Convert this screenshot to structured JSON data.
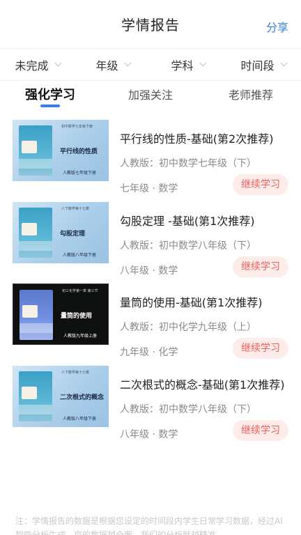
{
  "header": {
    "title": "学情报告",
    "share_label": "分享"
  },
  "filters": [
    "未完成",
    "年级",
    "学科",
    "时间段"
  ],
  "tabs": [
    {
      "label": "强化学习",
      "active": true
    },
    {
      "label": "加强关注",
      "active": false
    },
    {
      "label": "老师推荐",
      "active": false
    }
  ],
  "items": [
    {
      "title": "平行线的性质-基础(第2次推荐)",
      "edition": "人教版：初中数学七年级（下）",
      "meta": "七年级 · 数学",
      "action": "继续学习",
      "cover": {
        "subject": "数学",
        "topic": "平行线的性质",
        "headline": "初中数学七年级下册",
        "publisher": "人教版七年级下册"
      }
    },
    {
      "title": "勾股定理 -基础(第1次推荐)",
      "edition": "人教版：初中数学八年级（下）",
      "meta": "八年级 · 数学",
      "action": "继续学习",
      "cover": {
        "subject": "数学",
        "topic": "勾股定理",
        "headline": "八下数学第十七章",
        "publisher": "人教版八年级下册"
      }
    },
    {
      "title": "量筒的使用-基础(第1次推荐)",
      "edition": "人教版：初中化学九年级（上）",
      "meta": "九年级 · 化学",
      "action": "继续学习",
      "cover": {
        "subject": "化学",
        "topic": "量筒的使用",
        "headline": "初三化学第一章 第三节",
        "publisher": "人教版九年级上册"
      }
    },
    {
      "title": "二次根式的概念-基础(第1次推荐)",
      "edition": "人教版：初中数学八年级（下）",
      "meta": "八年级 · 数学",
      "action": "继续学习",
      "cover": {
        "subject": "数学",
        "topic": "二次根式的概念",
        "headline": "八下数学第十六章",
        "publisher": "人教版八年级下册"
      }
    }
  ],
  "footer_note": "注：学情报告的数据是根据您设定的时间段内学生日常学习数据，经过AI智能分析生成，您的数据越全面，我们的分析就越精准。",
  "colors": {
    "accent": "#3a7ee0",
    "cta_text": "#f0605a",
    "cta_bg": "#fdecea"
  }
}
